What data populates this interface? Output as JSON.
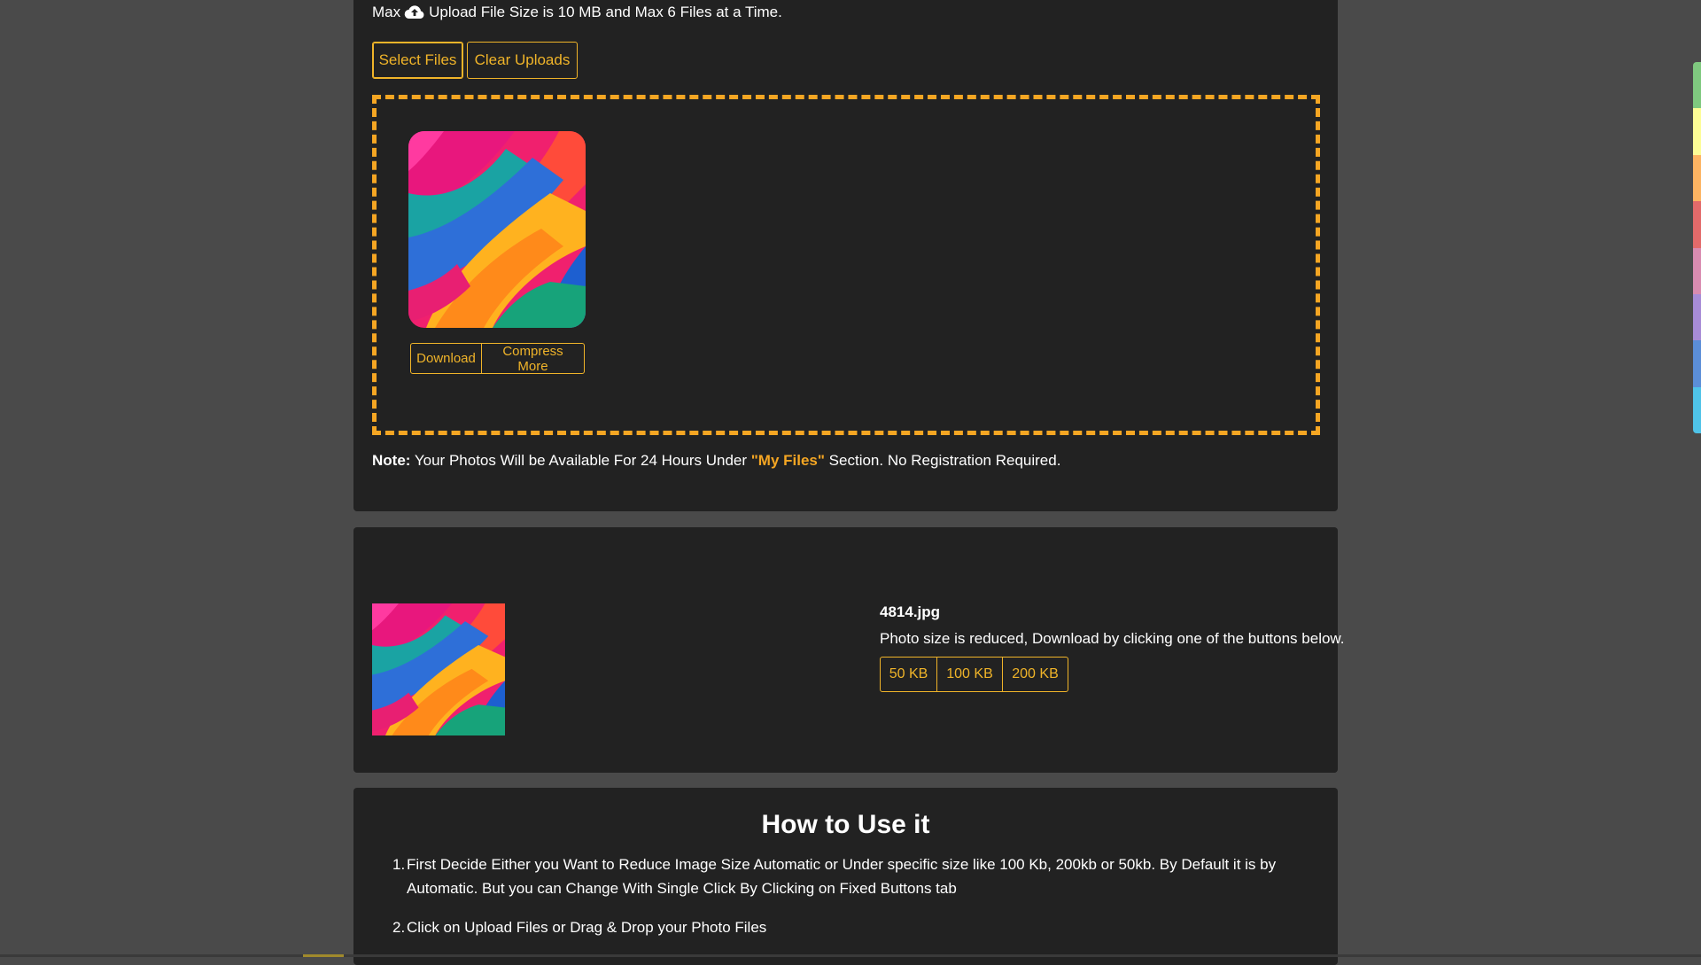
{
  "upload": {
    "max_prefix": "Max",
    "max_text": "Upload File Size is 10 MB and Max 6 Files at a Time.",
    "select_files_label": "Select Files",
    "clear_uploads_label": "Clear Uploads",
    "thumb_actions": {
      "download_label": "Download",
      "compress_more_label": "Compress More"
    },
    "note": {
      "bold": "Note:",
      "text_before": " Your Photos Will be Available For 24 Hours Under ",
      "highlight": "\"My Files\"",
      "text_after": " Section. No Registration Required."
    }
  },
  "result": {
    "file_name": "4814.jpg",
    "message": "Photo size is reduced, Download by clicking one of the buttons below.",
    "size_buttons": [
      "50 KB",
      "100 KB",
      "200 KB"
    ]
  },
  "howto": {
    "title": "How to Use it",
    "steps": [
      {
        "num": "1.",
        "text": "First Decide Either you Want to Reduce Image Size Automatic or Under specific size like 100 Kb, 200kb or 50kb. By Default it is by Automatic. But you can Change With Single Click By Clicking on Fixed Buttons tab"
      },
      {
        "num": "2.",
        "text": "Click on Upload Files or Drag & Drop your Photo Files"
      }
    ]
  },
  "icons": {
    "upload": "cloud-upload-icon"
  },
  "colors": {
    "accent": "#f0b429",
    "dashed_border": "#f5a623",
    "panel_bg": "#222222",
    "page_bg": "#4a4a4a",
    "side_strip": [
      "#7fc97f",
      "#fdfd96",
      "#fdb462",
      "#e36a6a",
      "#d98bb0",
      "#a78bd6",
      "#5b8ed8",
      "#4fc3e8"
    ]
  }
}
